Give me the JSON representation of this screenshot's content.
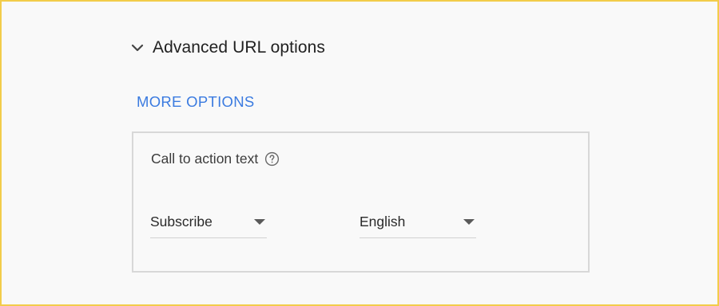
{
  "advanced_url": {
    "title": "Advanced URL options",
    "icon": "chevron-down-icon"
  },
  "more_options": {
    "label": "MORE OPTIONS",
    "color": "#3b7be0"
  },
  "call_to_action": {
    "label": "Call to action text",
    "help_icon": "help-circle-icon",
    "text_select": {
      "value": "Subscribe",
      "icon": "dropdown-arrow-icon"
    },
    "language_select": {
      "value": "English",
      "icon": "dropdown-arrow-icon"
    }
  },
  "colors": {
    "frame_border": "#f2cc4a",
    "panel_border": "#d8d8d8",
    "background": "#f9f9f9"
  }
}
